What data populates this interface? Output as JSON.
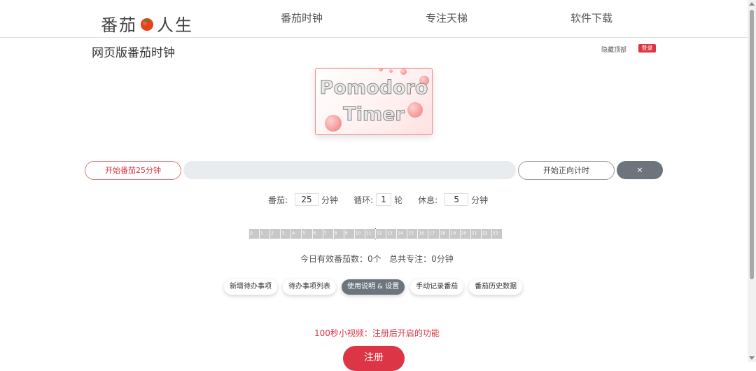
{
  "nav": {
    "brand_left": "番茄",
    "brand_right": "人生",
    "links": [
      "番茄时钟",
      "专注天梯",
      "软件下载"
    ]
  },
  "header": {
    "page_title": "网页版番茄时钟",
    "hide_top_label": "隐藏顶部",
    "login_label": "登录"
  },
  "logo": {
    "line1": "Pomodoro",
    "line2": "Timer"
  },
  "timer": {
    "start_label": "开始番茄25分钟",
    "countup_label": "开始正向计时",
    "close_label": "×",
    "progress": 0
  },
  "settings": {
    "pomodoro_label": "番茄:",
    "pomodoro_value": "25",
    "pomodoro_unit": "分钟",
    "cycle_label": "循环:",
    "cycle_value": "1",
    "cycle_unit": "轮",
    "rest_label": "休息:",
    "rest_value": "5",
    "rest_unit": "分钟"
  },
  "ruler": {
    "hours": [
      "0",
      "1",
      "2",
      "3",
      "4",
      "5",
      "6",
      "7",
      "8",
      "9",
      "10",
      "11",
      "12",
      "13",
      "14",
      "15",
      "16",
      "17",
      "18",
      "19",
      "20",
      "21",
      "22",
      "23"
    ]
  },
  "stats": {
    "text": "今日有效番茄数：0个   总共专注：0分钟"
  },
  "pills": [
    {
      "label": "新增待办事项",
      "active": false
    },
    {
      "label": "待办事项列表",
      "active": false
    },
    {
      "label": "使用说明 & 设置",
      "active": true
    },
    {
      "label": "手动记录番茄",
      "active": false
    },
    {
      "label": "番茄历史数据",
      "active": false
    }
  ],
  "footer": {
    "video_note": "100秒小视频：注册后开启的功能",
    "register_label": "注册"
  },
  "colors": {
    "accent": "#dc3545",
    "gray_button": "#6c757d"
  }
}
